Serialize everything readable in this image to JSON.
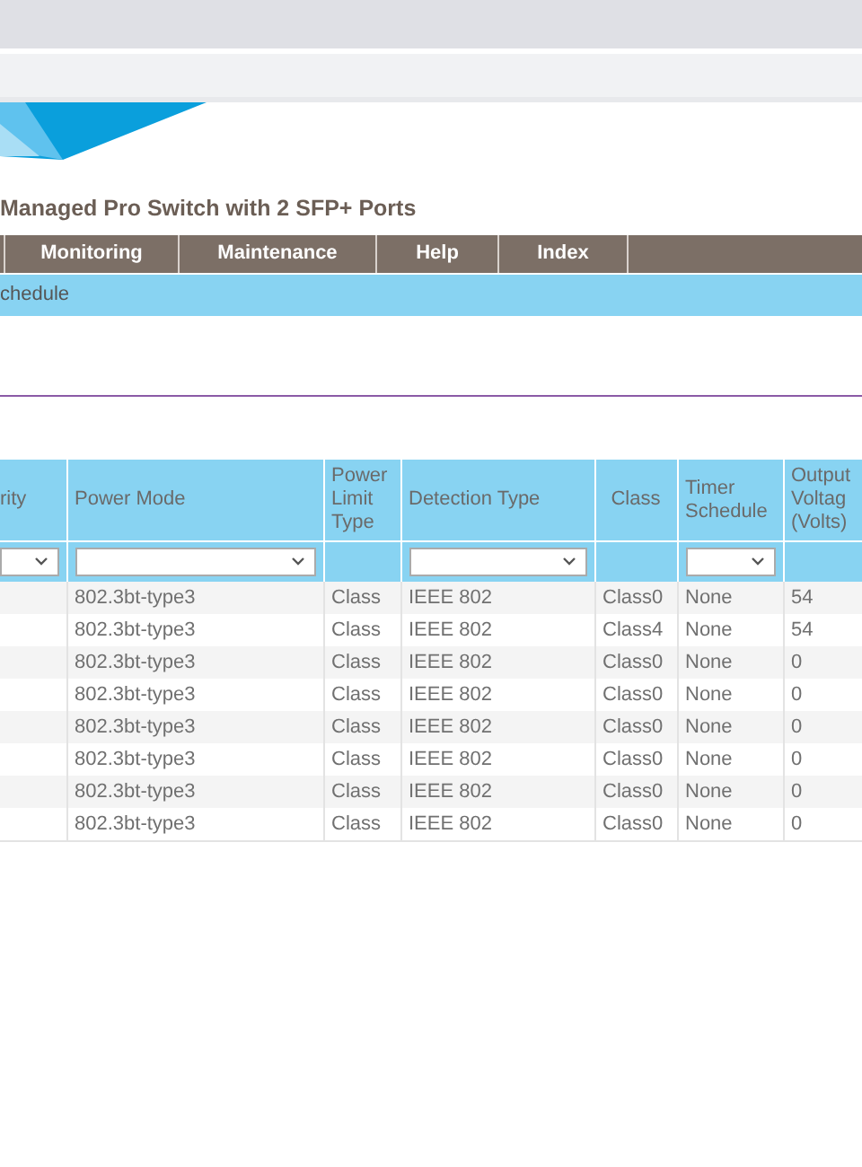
{
  "page_title": "Managed Pro Switch with 2 SFP+ Ports",
  "nav": [
    {
      "label": "Monitoring"
    },
    {
      "label": "Maintenance"
    },
    {
      "label": "Help"
    },
    {
      "label": "Index"
    }
  ],
  "subnav": {
    "label": "chedule"
  },
  "table": {
    "columns": [
      {
        "label": "rity",
        "filter": true
      },
      {
        "label": "Power Mode",
        "filter": true
      },
      {
        "label": "Power Limit Type",
        "filter": false
      },
      {
        "label": "Detection Type",
        "filter": true
      },
      {
        "label": "Class",
        "filter": false
      },
      {
        "label": "Timer Schedule",
        "filter": true
      },
      {
        "label": "Output Voltag (Volts)",
        "filter": false
      }
    ],
    "rows": [
      [
        "",
        "802.3bt-type3",
        "Class",
        "IEEE 802",
        "Class0",
        "None",
        "54"
      ],
      [
        "",
        "802.3bt-type3",
        "Class",
        "IEEE 802",
        "Class4",
        "None",
        "54"
      ],
      [
        "",
        "802.3bt-type3",
        "Class",
        "IEEE 802",
        "Class0",
        "None",
        "0"
      ],
      [
        "",
        "802.3bt-type3",
        "Class",
        "IEEE 802",
        "Class0",
        "None",
        "0"
      ],
      [
        "",
        "802.3bt-type3",
        "Class",
        "IEEE 802",
        "Class0",
        "None",
        "0"
      ],
      [
        "",
        "802.3bt-type3",
        "Class",
        "IEEE 802",
        "Class0",
        "None",
        "0"
      ],
      [
        "",
        "802.3bt-type3",
        "Class",
        "IEEE 802",
        "Class0",
        "None",
        "0"
      ],
      [
        "",
        "802.3bt-type3",
        "Class",
        "IEEE 802",
        "Class0",
        "None",
        "0"
      ]
    ]
  }
}
